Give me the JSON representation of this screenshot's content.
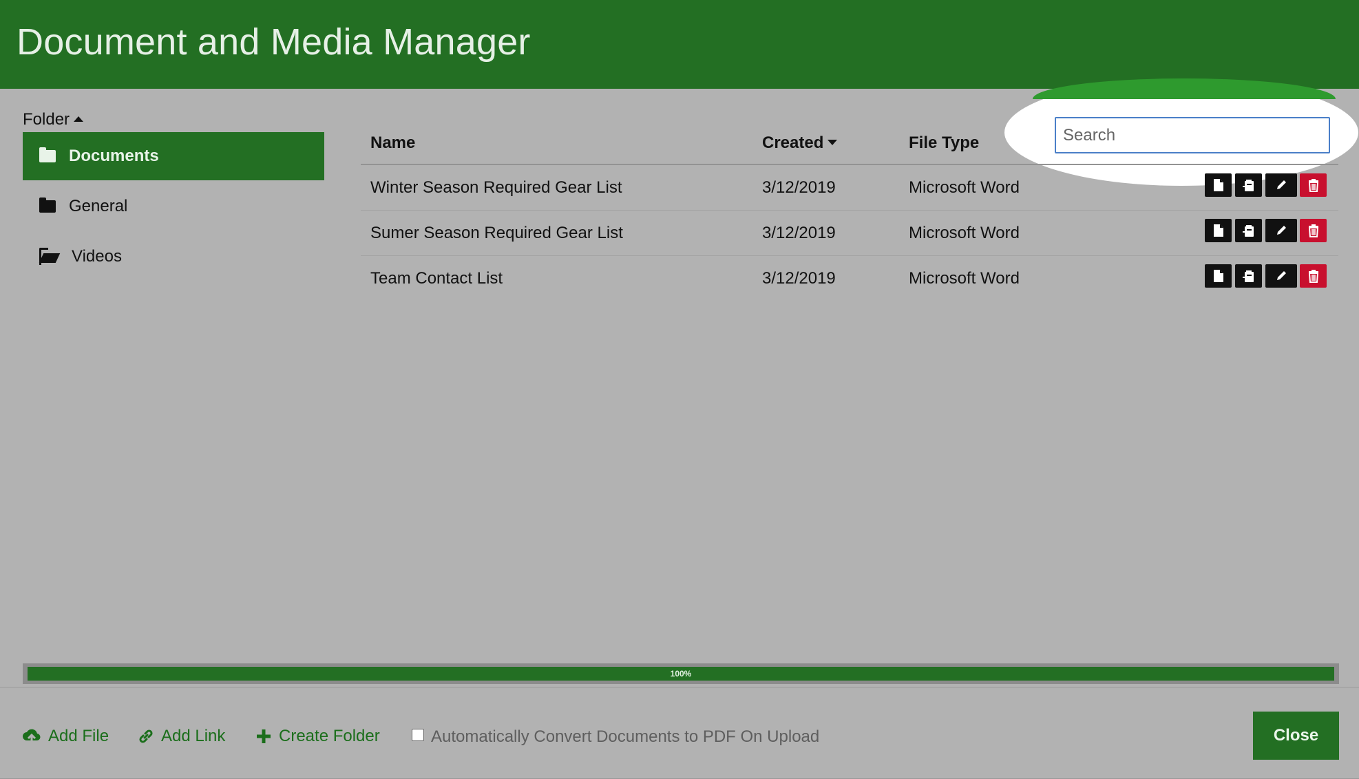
{
  "header": {
    "title": "Document and Media Manager"
  },
  "sidebar": {
    "heading": "Folder",
    "items": [
      {
        "label": "Documents",
        "icon": "folder-icon",
        "active": true
      },
      {
        "label": "General",
        "icon": "folder-icon",
        "active": false
      },
      {
        "label": "Videos",
        "icon": "folder-open-icon",
        "active": false
      }
    ]
  },
  "search": {
    "placeholder": "Search",
    "value": ""
  },
  "table": {
    "columns": {
      "name": "Name",
      "created": "Created",
      "file_type": "File Type"
    },
    "rows": [
      {
        "name": "Winter Season Required Gear List",
        "created": "3/12/2019",
        "file_type": "Microsoft Word"
      },
      {
        "name": "Sumer Season Required Gear List",
        "created": "3/12/2019",
        "file_type": "Microsoft Word"
      },
      {
        "name": "Team Contact List",
        "created": "3/12/2019",
        "file_type": "Microsoft Word"
      }
    ],
    "row_actions": [
      "file-icon",
      "copy-icon",
      "pencil-icon",
      "trash-icon"
    ]
  },
  "upload": {
    "progress_label": "100%",
    "progress_percent": 100
  },
  "footer": {
    "add_file": "Add File",
    "add_link": "Add Link",
    "create_folder": "Create Folder",
    "auto_convert_label": "Automatically Convert Documents to PDF On Upload",
    "auto_convert_checked": false,
    "close": "Close"
  },
  "colors": {
    "brand_green": "#236f23",
    "overlay_gray": "#b2b2b2",
    "danger_red": "#c8102e",
    "link_green": "#1b6e1b"
  }
}
